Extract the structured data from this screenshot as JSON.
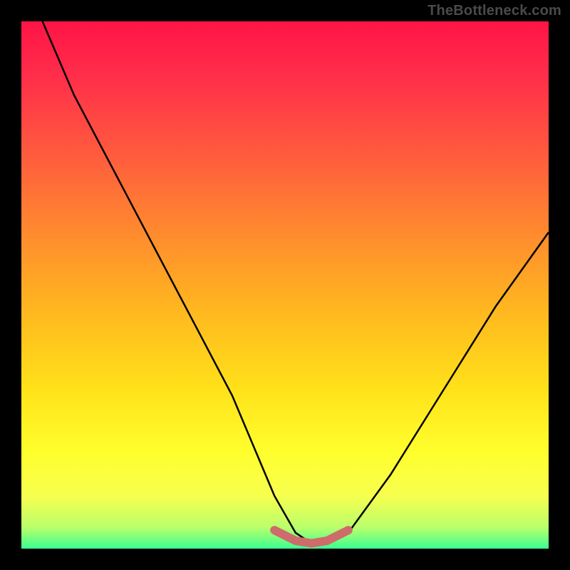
{
  "watermark": "TheBottleneck.com",
  "colors": {
    "frame": "#000000",
    "gradient_top": "#ff1446",
    "gradient_mid": "#ffe21a",
    "gradient_bottom": "#3bff92",
    "curve": "#000000",
    "band": "#cf6b6b"
  },
  "chart_data": {
    "type": "line",
    "title": "",
    "xlabel": "",
    "ylabel": "",
    "xlim": [
      0,
      100
    ],
    "ylim": [
      0,
      100
    ],
    "grid": false,
    "series": [
      {
        "name": "bottleneck-curve",
        "x": [
          4,
          10,
          20,
          30,
          40,
          48,
          52,
          55,
          58,
          62,
          70,
          80,
          90,
          100
        ],
        "y": [
          100,
          86,
          67,
          48,
          29,
          10,
          3,
          1,
          1,
          3,
          14,
          30,
          46,
          60
        ]
      }
    ],
    "highlight_band": {
      "name": "highlight-band",
      "x": [
        48,
        52,
        55,
        58,
        62
      ],
      "y": [
        3.5,
        1.5,
        1,
        1.5,
        3.5
      ]
    }
  }
}
